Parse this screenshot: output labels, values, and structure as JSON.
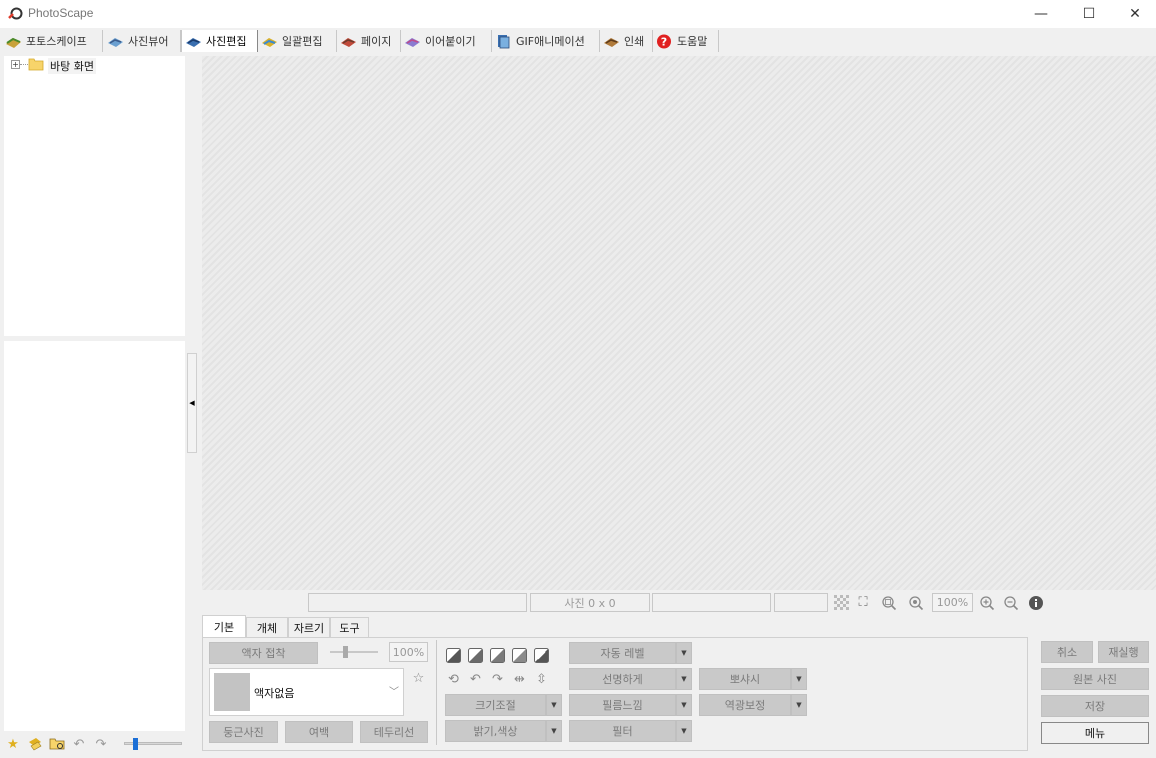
{
  "window": {
    "title": "PhotoScape",
    "minimize": "—",
    "maximize": "☐",
    "close": "✕"
  },
  "tabs": [
    {
      "label": "포토스케이프"
    },
    {
      "label": "사진뷰어"
    },
    {
      "label": "사진편집"
    },
    {
      "label": "일괄편집"
    },
    {
      "label": "페이지"
    },
    {
      "label": "이어붙이기"
    },
    {
      "label": "GIF애니메이션"
    },
    {
      "label": "인쇄"
    },
    {
      "label": "도움말"
    }
  ],
  "active_tab": "사진편집",
  "tree": {
    "expander": "+",
    "root_label": "바탕 화면"
  },
  "status": {
    "photo_size": "사진 0 x 0",
    "zoom": "100%"
  },
  "bottom_tabs": [
    {
      "label": "기본"
    },
    {
      "label": "개체"
    },
    {
      "label": "자르기"
    },
    {
      "label": "도구"
    }
  ],
  "basic": {
    "frame_attach": "액자 접착",
    "frame_opacity": "100%",
    "frame_none": "액자없음",
    "round_photo": "둥근사진",
    "margin": "여백",
    "border_line": "테두리선",
    "resize": "크기조절",
    "brightness_color": "밝기,색상",
    "auto_level": "자동 레벨",
    "sharpen": "선명하게",
    "film_effect": "필름느낌",
    "filter": "필터",
    "backlight": "뽀샤시",
    "backlight_correct": "역광보정"
  },
  "right_buttons": {
    "undo": "취소",
    "redo": "재실행",
    "original": "원본 사진",
    "save": "저장",
    "menu": "메뉴"
  },
  "colors": {
    "accent": "#1b6fd6",
    "help_red": "#e02020",
    "button_gray": "#c9c9c9"
  }
}
